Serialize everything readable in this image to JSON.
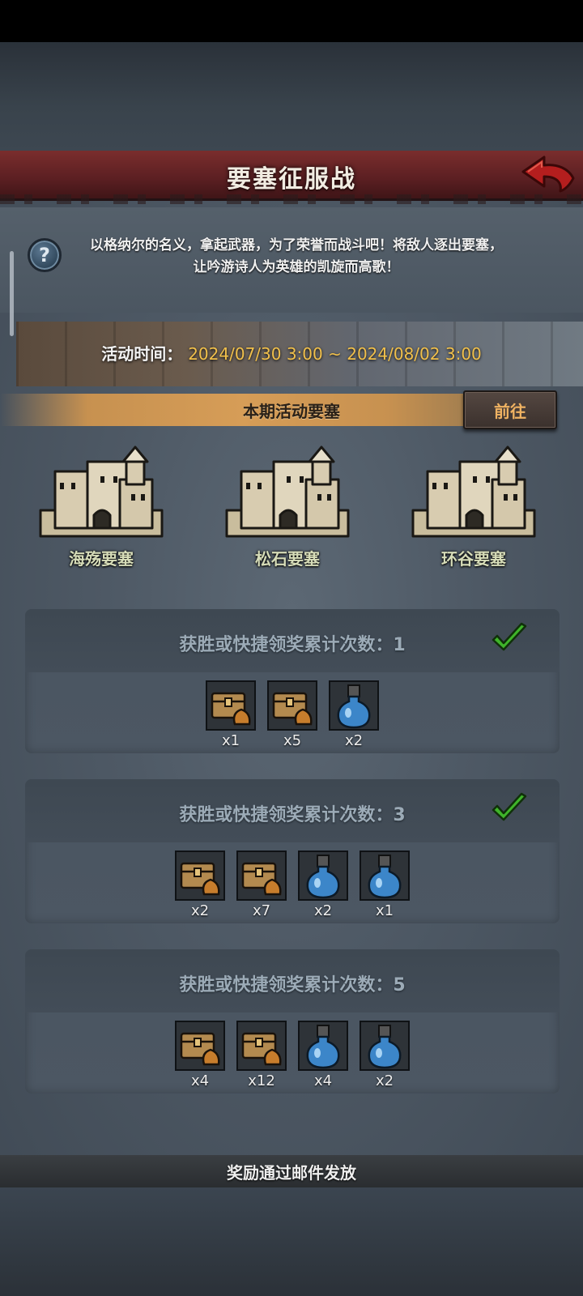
{
  "header": {
    "title": "要塞征服战"
  },
  "description": {
    "line1": "以格纳尔的名义，拿起武器，为了荣誉而战斗吧！将敌人逐出要塞，",
    "line2": "让吟游诗人为英雄的凯旋而高歌！"
  },
  "event_time": {
    "label": "活动时间：",
    "value": "2024/07/30 3:00 ~ 2024/08/02 3:00"
  },
  "period": {
    "label": "本期活动要塞",
    "goto_label": "前往"
  },
  "fortresses": [
    {
      "name": "海殇要塞"
    },
    {
      "name": "松石要塞"
    },
    {
      "name": "环谷要塞"
    }
  ],
  "rewards": [
    {
      "title": "获胜或快捷领奖累计次数：1",
      "completed": true,
      "items": [
        {
          "icon": "chest-bag-icon",
          "qty": "x1"
        },
        {
          "icon": "chest-bag-icon",
          "qty": "x5"
        },
        {
          "icon": "blue-potion-icon",
          "qty": "x2"
        }
      ]
    },
    {
      "title": "获胜或快捷领奖累计次数：3",
      "completed": true,
      "items": [
        {
          "icon": "chest-bag-icon",
          "qty": "x2"
        },
        {
          "icon": "chest-bag-icon",
          "qty": "x7"
        },
        {
          "icon": "blue-potion-icon",
          "qty": "x2"
        },
        {
          "icon": "blue-potion-icon",
          "qty": "x1"
        }
      ]
    },
    {
      "title": "获胜或快捷领奖累计次数：5",
      "completed": false,
      "items": [
        {
          "icon": "chest-bag-icon",
          "qty": "x4"
        },
        {
          "icon": "chest-bag-icon",
          "qty": "x12"
        },
        {
          "icon": "blue-potion-icon",
          "qty": "x4"
        },
        {
          "icon": "blue-potion-icon",
          "qty": "x2"
        }
      ]
    }
  ],
  "footer": {
    "text": "奖励通过邮件发放"
  },
  "colors": {
    "accent_gold": "#f1c04b",
    "header_red": "#6b2628",
    "check_green": "#3fb42a"
  }
}
